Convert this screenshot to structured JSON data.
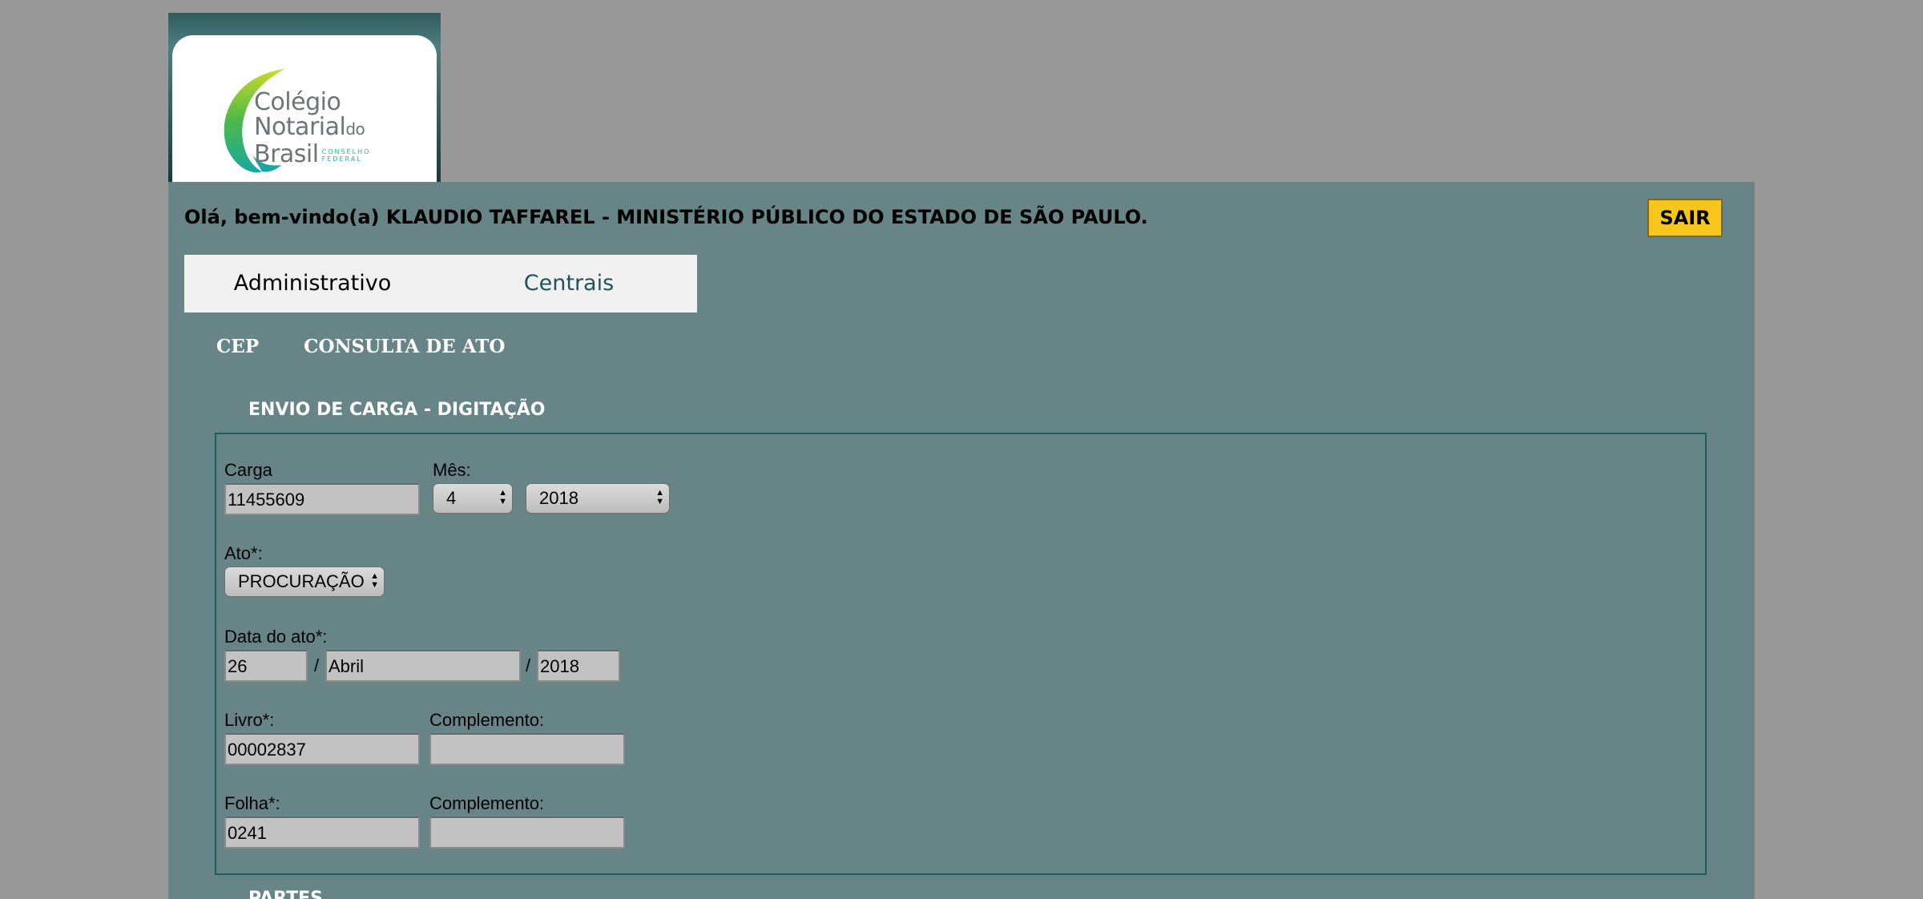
{
  "logo": {
    "line1": "Colégio",
    "line2": "Notarial",
    "line2_small": "do",
    "line3": "Brasil",
    "tag1": "CONSELHO",
    "tag2": "FEDERAL"
  },
  "header": {
    "welcome": "Olá, bem-vindo(a) KLAUDIO TAFFAREL - MINISTÉRIO PÚBLICO DO ESTADO DE SÃO PAULO.",
    "logout_label": "SAIR"
  },
  "menu": {
    "items": [
      {
        "label": "Administrativo"
      },
      {
        "label": "Centrais"
      }
    ]
  },
  "submenu": {
    "items": [
      {
        "label": "CEP"
      },
      {
        "label": "CONSULTA DE ATO"
      }
    ]
  },
  "form": {
    "section_title": "ENVIO DE CARGA - DIGITAÇÃO",
    "carga": {
      "label": "Carga",
      "value": "11455609"
    },
    "mes": {
      "label": "Mês:",
      "month": "4",
      "year": "2018"
    },
    "ato": {
      "label": "Ato*:",
      "value": "PROCURAÇÃO"
    },
    "data_ato": {
      "label": "Data do ato*:",
      "day": "26",
      "month": "Abril",
      "year": "2018",
      "separator": "/"
    },
    "livro": {
      "label": "Livro*:",
      "value": "00002837",
      "complemento_label": "Complemento:",
      "complemento_value": ""
    },
    "folha": {
      "label": "Folha*:",
      "value": "0241",
      "complemento_label": "Complemento:",
      "complemento_value": ""
    }
  },
  "partes": {
    "section_title": "PARTES"
  }
}
